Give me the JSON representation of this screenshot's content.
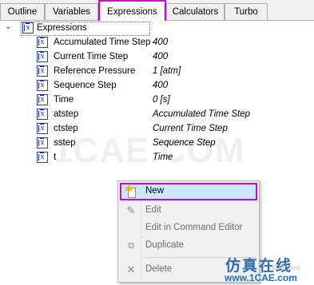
{
  "tabs": [
    {
      "label": "Outline",
      "active": false
    },
    {
      "label": "Variables",
      "active": false
    },
    {
      "label": "Expressions",
      "active": true
    },
    {
      "label": "Calculators",
      "active": false
    },
    {
      "label": "Turbo",
      "active": false
    }
  ],
  "tree": {
    "root_label": "Expressions",
    "expanded": true,
    "items": [
      {
        "name": "Accumulated Time Step",
        "value": "400"
      },
      {
        "name": "Current Time Step",
        "value": "400"
      },
      {
        "name": "Reference Pressure",
        "value": "1 [atm]"
      },
      {
        "name": "Sequence Step",
        "value": "400"
      },
      {
        "name": "Time",
        "value": "0 [s]"
      },
      {
        "name": "atstep",
        "value": "Accumulated Time Step"
      },
      {
        "name": "ctstep",
        "value": "Current Time Step"
      },
      {
        "name": "sstep",
        "value": "Sequence Step"
      },
      {
        "name": "t",
        "value": "Time"
      }
    ]
  },
  "context_menu": {
    "items": [
      {
        "label": "New",
        "icon": "new-item-icon",
        "enabled": true,
        "highlighted": true
      },
      {
        "label": "Edit",
        "icon": "edit-brush-icon",
        "enabled": false
      },
      {
        "label": "Edit in Command Editor",
        "icon": "",
        "enabled": false
      },
      {
        "label": "Duplicate",
        "icon": "duplicate-icon",
        "enabled": false
      },
      {
        "label": "Delete",
        "icon": "delete-x-icon",
        "enabled": false
      }
    ]
  },
  "watermark": "1CAE.COM",
  "brand": {
    "chinese": "仿真在线",
    "url": "www.1CAE.com",
    "small": "ICAE.com"
  },
  "colors": {
    "highlight_border": "#d400d4",
    "menu_hover": "#cce8ff",
    "icon_blue": "#1d2f8f"
  }
}
